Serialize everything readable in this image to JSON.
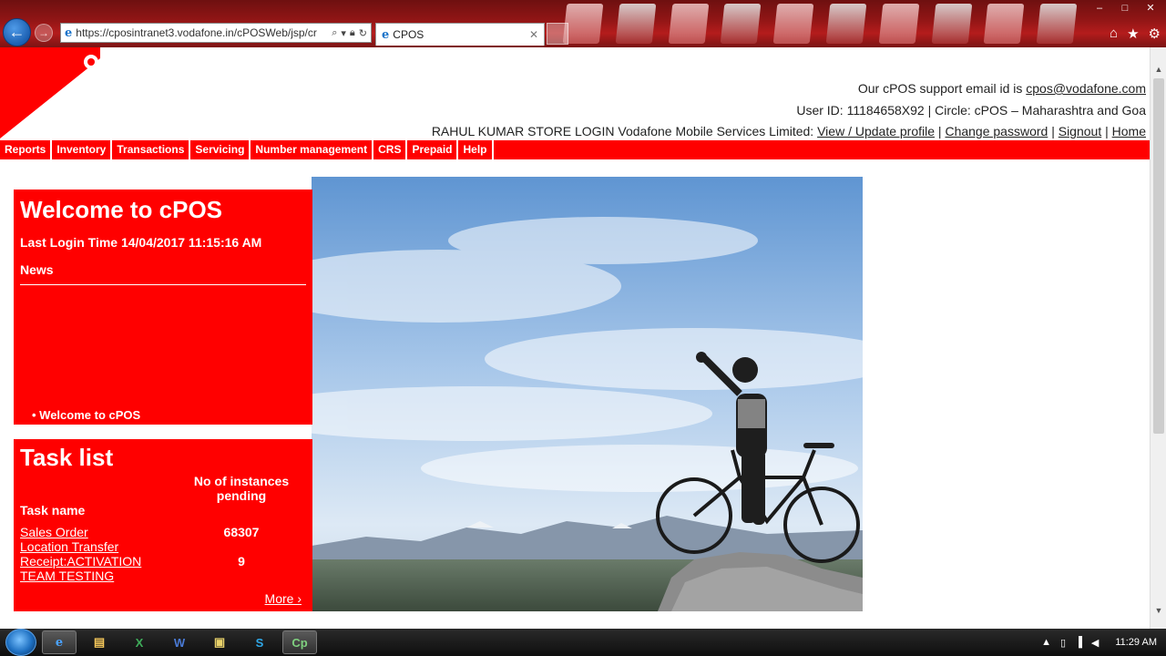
{
  "browser": {
    "url": "https://cposintranet3.vodafone.in/cPOSWeb/jsp/cr",
    "tab_title": "CPOS",
    "back_label": "←",
    "forward_label": "→",
    "window_controls": [
      "–",
      "□",
      "✕"
    ],
    "tools": [
      "home-icon",
      "star-icon",
      "gear-icon"
    ]
  },
  "header": {
    "support_prefix": "Our cPOS support email id is ",
    "support_email": "cpos@vodafone.com",
    "user_line": "User ID: 11184658X92 | Circle: cPOS – Maharashtra and Goa",
    "store_prefix": "RAHUL KUMAR STORE LOGIN Vodafone Mobile Services Limited: ",
    "links": {
      "view_profile": "View / Update profile",
      "change_password": "Change password",
      "signout": "Signout",
      "home": "Home"
    },
    "separator": " | "
  },
  "menu": [
    {
      "label": "Reports"
    },
    {
      "label": "Inventory"
    },
    {
      "label": "Transactions"
    },
    {
      "label": "Servicing"
    },
    {
      "label": "Number management"
    },
    {
      "label": "CRS"
    },
    {
      "label": "Prepaid"
    },
    {
      "label": "Help"
    }
  ],
  "welcome": {
    "title": "Welcome to cPOS",
    "last_login": "Last Login Time 14/04/2017 11:15:16 AM",
    "news_label": "News",
    "news_item": "•  Welcome to cPOS"
  },
  "tasks": {
    "title": "Task list",
    "col_name": "Task name",
    "col_count": "No of instances pending",
    "rows": [
      {
        "name": "Sales Order",
        "count": "68307"
      },
      {
        "name": "Location Transfer",
        "count": ""
      },
      {
        "name": "Receipt:ACTIVATION",
        "count": "9"
      },
      {
        "name": "TEAM TESTING",
        "count": ""
      }
    ],
    "more": "More ›"
  },
  "taskbar": {
    "apps": [
      "ie-icon",
      "folder-icon",
      "excel-icon",
      "word-icon",
      "explorer-icon",
      "skype-icon",
      "cpos-icon"
    ],
    "clock": "11:29 AM"
  },
  "colors": {
    "brand_red": "#ff0000",
    "chrome_red": "#8f1515"
  }
}
